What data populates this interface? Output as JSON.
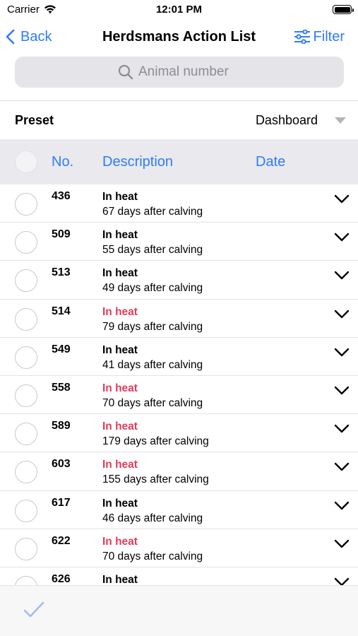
{
  "status_bar": {
    "carrier": "Carrier",
    "time": "12:01 PM"
  },
  "nav": {
    "back_label": "Back",
    "title": "Herdsmans Action List",
    "filter_label": "Filter"
  },
  "search": {
    "placeholder": "Animal number",
    "value": ""
  },
  "preset": {
    "label": "Preset",
    "value": "Dashboard"
  },
  "columns": {
    "no": "No.",
    "description": "Description",
    "date": "Date"
  },
  "colors": {
    "accent": "#2f7cf6",
    "alert": "#e23c5a",
    "header_bg": "#e9e9ee"
  },
  "rows": [
    {
      "no": "436",
      "status": "In heat",
      "alert": false,
      "sub": "67 days after calving"
    },
    {
      "no": "509",
      "status": "In heat",
      "alert": false,
      "sub": "55 days after calving"
    },
    {
      "no": "513",
      "status": "In heat",
      "alert": false,
      "sub": "49 days after calving"
    },
    {
      "no": "514",
      "status": "In heat",
      "alert": true,
      "sub": "79 days after calving"
    },
    {
      "no": "549",
      "status": "In heat",
      "alert": false,
      "sub": "41 days after calving"
    },
    {
      "no": "558",
      "status": "In heat",
      "alert": true,
      "sub": "70 days after calving"
    },
    {
      "no": "589",
      "status": "In heat",
      "alert": true,
      "sub": "179 days after calving"
    },
    {
      "no": "603",
      "status": "In heat",
      "alert": true,
      "sub": "155 days after calving"
    },
    {
      "no": "617",
      "status": "In heat",
      "alert": false,
      "sub": "46 days after calving"
    },
    {
      "no": "622",
      "status": "In heat",
      "alert": true,
      "sub": "70 days after calving"
    },
    {
      "no": "626",
      "status": "In heat",
      "alert": false,
      "sub": ""
    }
  ],
  "icons": {
    "back": "chevron-left-icon",
    "filter": "sliders-icon",
    "search": "magnifier-icon",
    "row_expand": "chevron-down-icon",
    "done": "checkmark-icon"
  }
}
